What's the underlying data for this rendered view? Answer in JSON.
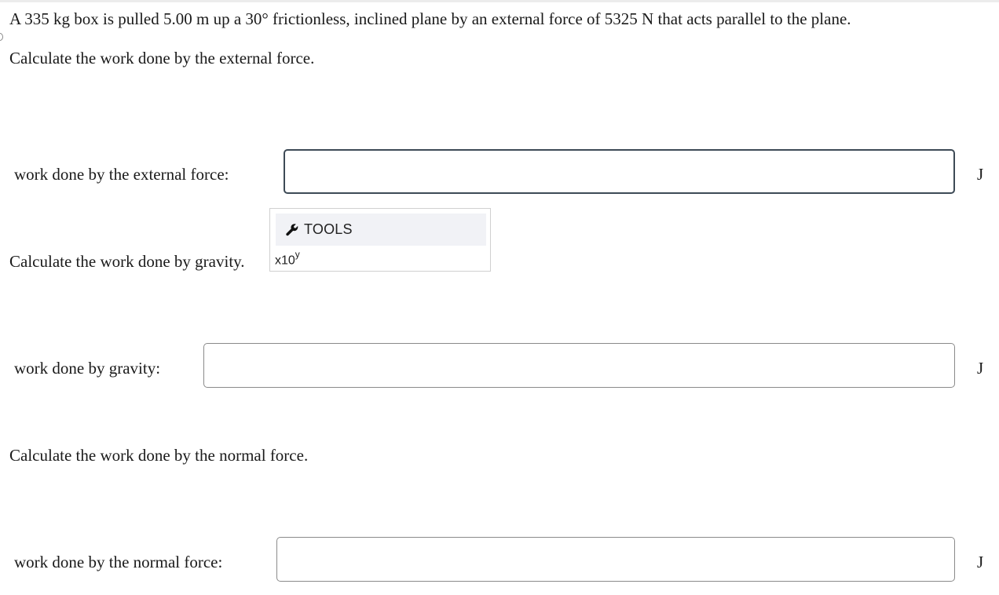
{
  "problem": {
    "intro": "A 335 kg box is pulled 5.00 m up a 30° frictionless, inclined plane by an external force of 5325 N that acts parallel to the plane."
  },
  "parts": [
    {
      "question": "Calculate the work done by the external force.",
      "label": "work done by the external force:",
      "value": "",
      "unit": "J"
    },
    {
      "question": "Calculate the work done by gravity.",
      "label": "work done by gravity:",
      "value": "",
      "unit": "J"
    },
    {
      "question": "Calculate the work done by the normal force.",
      "label": "work done by the normal force:",
      "value": "",
      "unit": "J"
    }
  ],
  "tools": {
    "header_label": "TOOLS",
    "header_icon": "wrench-icon",
    "sci_notation_base": "x10",
    "sci_notation_exp": "y"
  },
  "colors": {
    "focused_border": "#3d4a56",
    "input_border": "#8a8a8a",
    "tools_header_bg": "#f1f2f6"
  }
}
